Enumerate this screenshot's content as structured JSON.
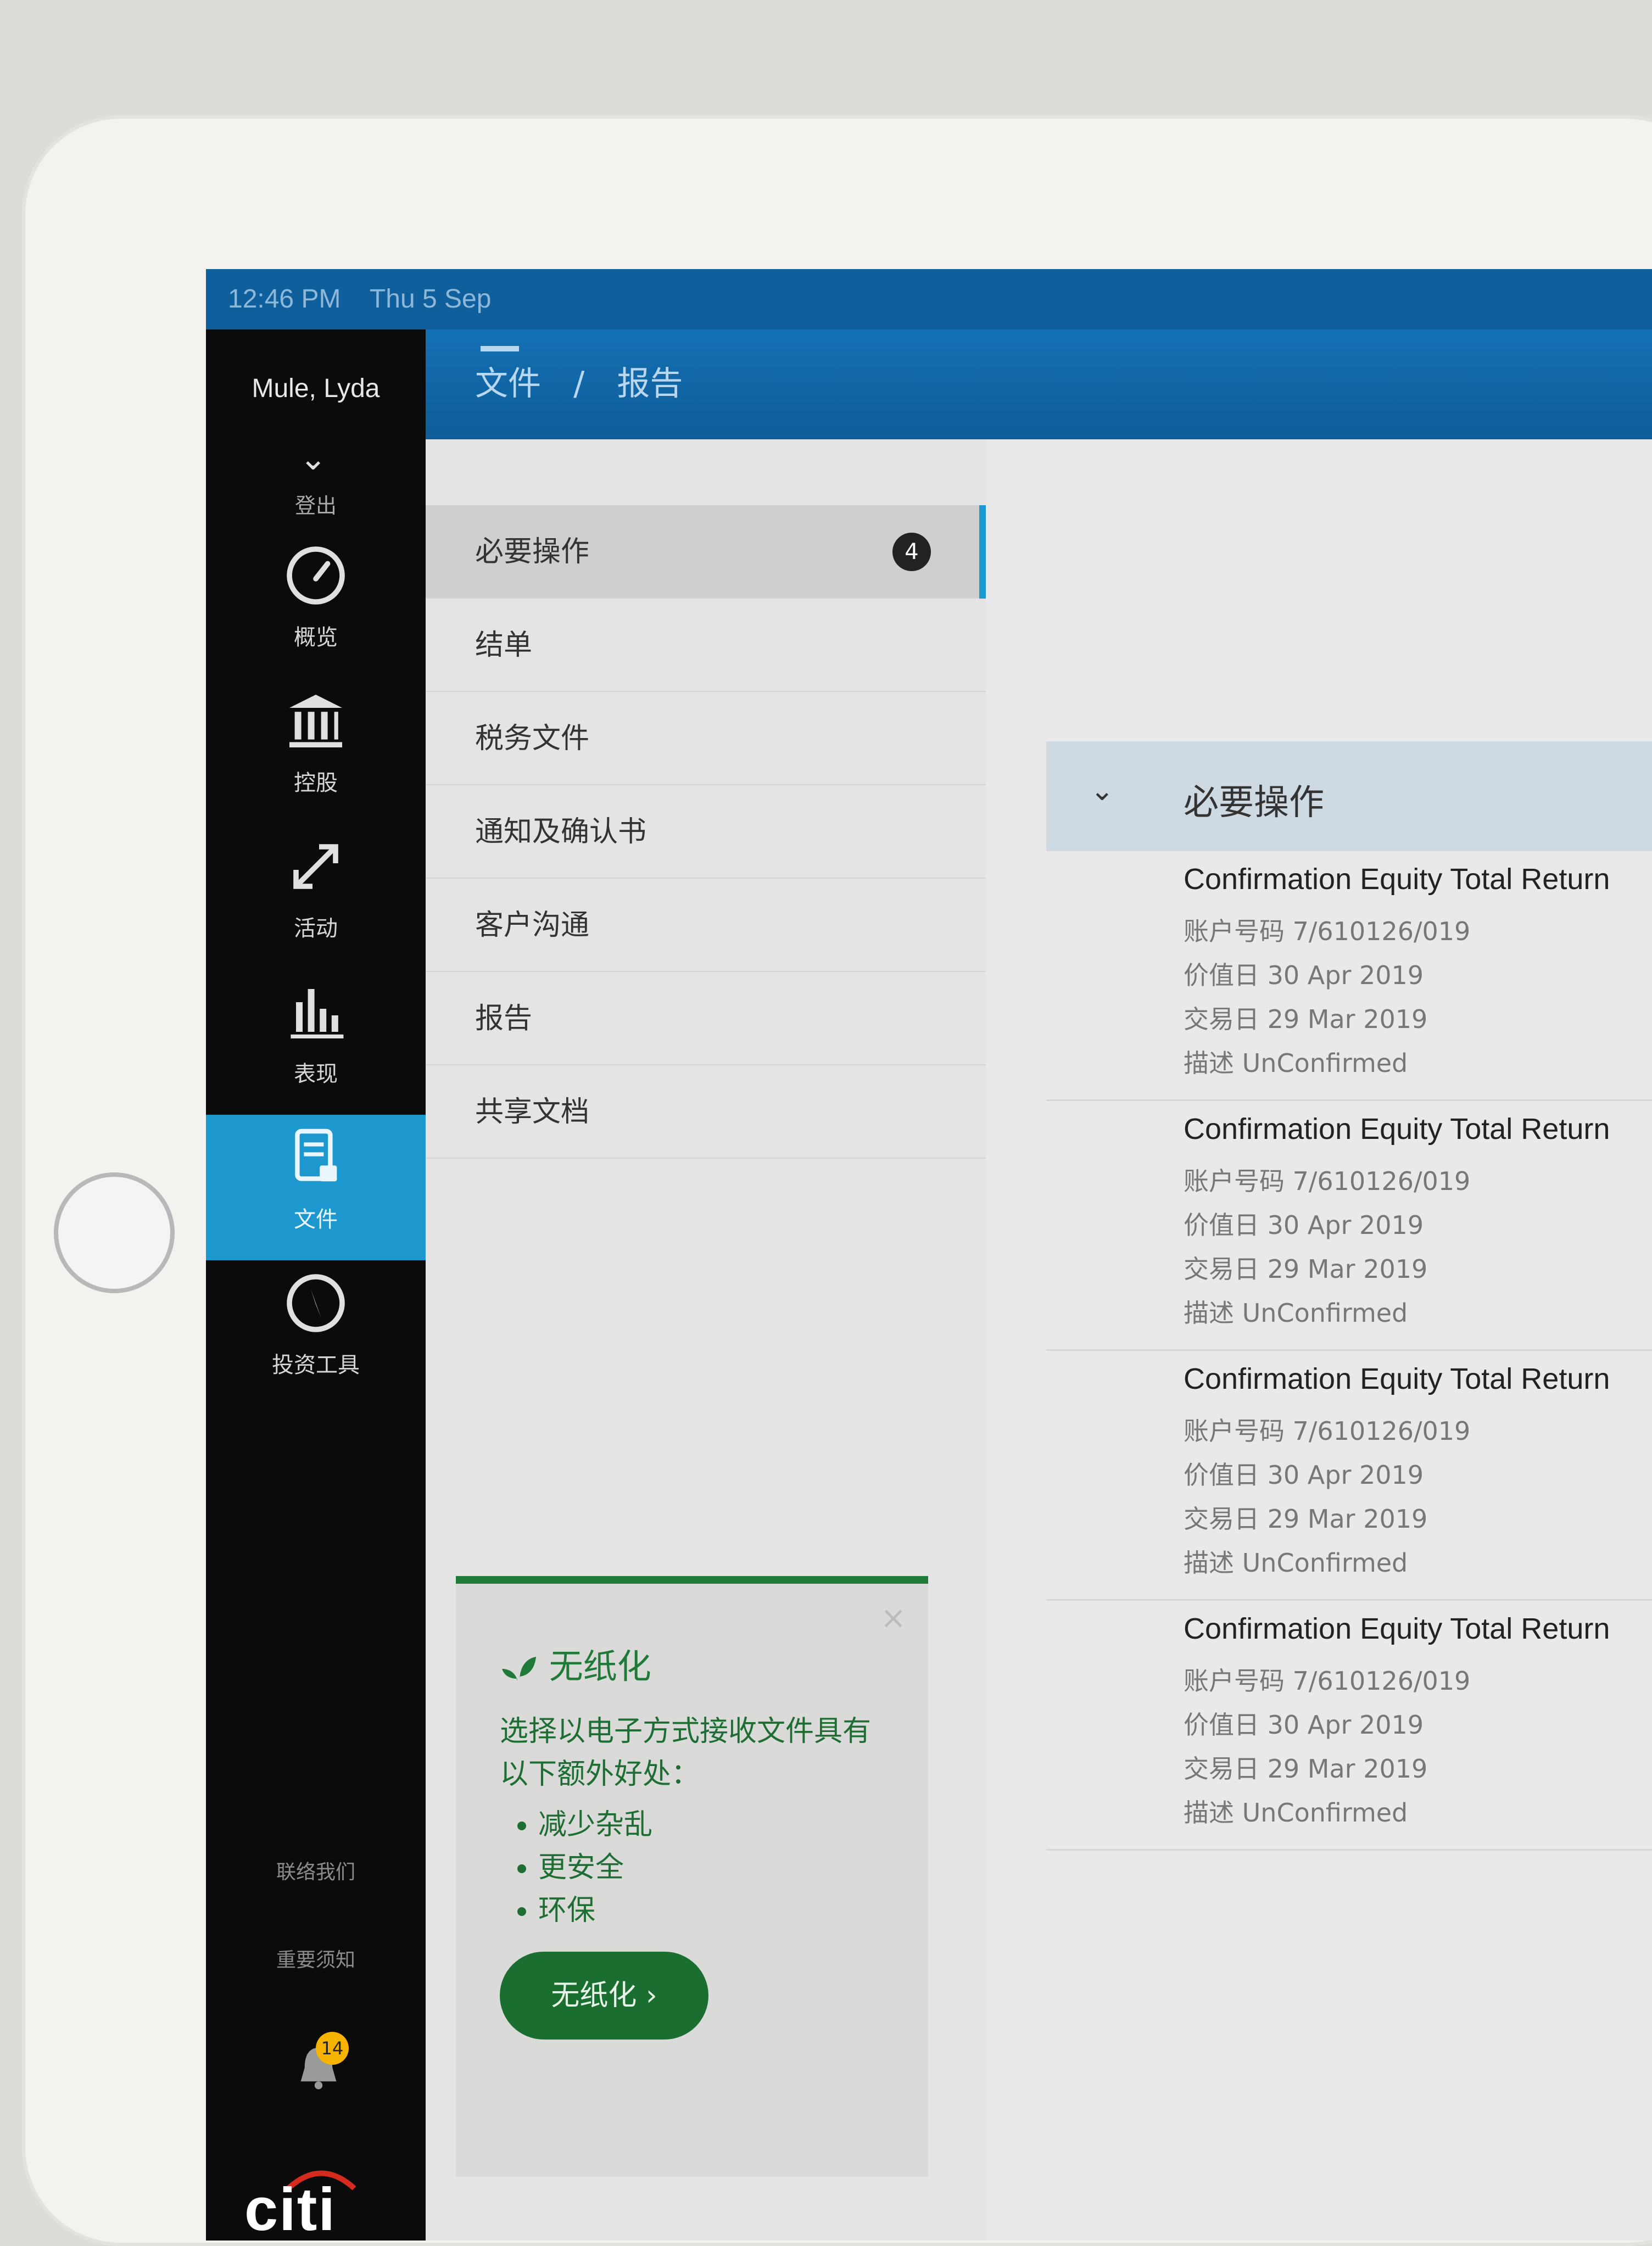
{
  "status": {
    "time": "12:46 PM",
    "date": "Thu 5 Sep"
  },
  "user": {
    "name": "Mule, Lyda",
    "logout_label": "登出"
  },
  "nav": [
    {
      "label": "概览",
      "icon": "gauge-icon"
    },
    {
      "label": "控股",
      "icon": "bank-icon"
    },
    {
      "label": "活动",
      "icon": "arrows-icon"
    },
    {
      "label": "表现",
      "icon": "bar-chart-icon"
    },
    {
      "label": "文件",
      "icon": "document-lock-icon"
    },
    {
      "label": "投资工具",
      "icon": "compass-icon"
    }
  ],
  "side_links": {
    "contact": "联络我们",
    "notice": "重要须知"
  },
  "notifications": {
    "count": "14"
  },
  "brand": {
    "logo": "citi"
  },
  "breadcrumb": {
    "root": "文件",
    "separator": "/",
    "current": "报告"
  },
  "doc_nav": [
    {
      "label": "必要操作",
      "badge": "4"
    },
    {
      "label": "结单"
    },
    {
      "label": "税务文件"
    },
    {
      "label": "通知及确认书"
    },
    {
      "label": "客户沟通"
    },
    {
      "label": "报告"
    },
    {
      "label": "共享文档"
    }
  ],
  "promo": {
    "title": "无纸化",
    "text": "选择以电子方式接收文件具有以下额外好处：",
    "bullets": [
      "减少杂乱",
      "更安全",
      "环保"
    ],
    "button": "无纸化",
    "close": "×"
  },
  "section": {
    "title": "必要操作"
  },
  "cards": [
    {
      "title": "Confirmation Equity Total Return",
      "account": "账户号码 7/610126/019",
      "value_date": "价值日 30 Apr 2019",
      "trade_date": "交易日 29 Mar 2019",
      "description": "描述 UnConfirmed"
    },
    {
      "title": "Confirmation Equity Total Return",
      "account": "账户号码 7/610126/019",
      "value_date": "价值日 30 Apr 2019",
      "trade_date": "交易日 29 Mar 2019",
      "description": "描述 UnConfirmed"
    },
    {
      "title": "Confirmation Equity Total Return",
      "account": "账户号码 7/610126/019",
      "value_date": "价值日 30 Apr 2019",
      "trade_date": "交易日 29 Mar 2019",
      "description": "描述 UnConfirmed"
    },
    {
      "title": "Confirmation Equity Total Return",
      "account": "账户号码 7/610126/019",
      "value_date": "价值日 30 Apr 2019",
      "trade_date": "交易日 29 Mar 2019",
      "description": "描述 UnConfirmed"
    }
  ],
  "colors": {
    "accent": "#1d98cf",
    "header": "#1470b4",
    "paperless": "#1f7a3a"
  }
}
